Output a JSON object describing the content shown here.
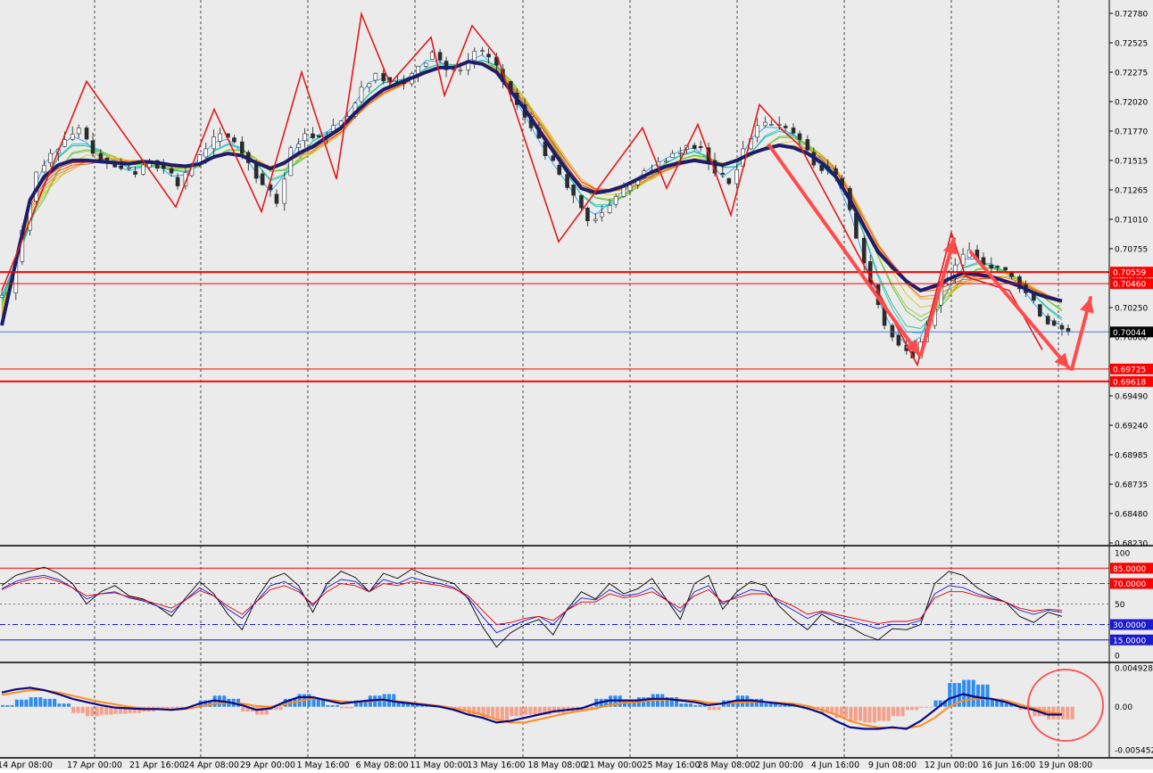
{
  "colors": {
    "background": "#ebebeb",
    "grid_vline": "#222222",
    "ema_main": "#1d1d6b",
    "zigzag": "#e11b1b",
    "arrow": "#ff4b4b",
    "level_red": "#ff0000",
    "price_line": "#4a78d6",
    "rsi_fast": "#000000",
    "rsi_mid": "#1a1ad0",
    "rsi_slow": "#e00000",
    "macd_pos": "#2f8cf0",
    "macd_neg": "#f4a08a",
    "macd_line": "#0a0a8a",
    "signal_line": "#ff8c1a",
    "circle": "#ff4b4b"
  },
  "chart_data": [
    {
      "type": "line",
      "symbol": "candlestick price panel",
      "x_labels": [
        "14 Apr 08:00",
        "17 Apr 00:00",
        "21 Apr 16:00",
        "24 Apr 08:00",
        "29 Apr 00:00",
        "1 May 16:00",
        "6 May 08:00",
        "11 May 00:00",
        "13 May 16:00",
        "18 May 08:00",
        "21 May 00:00",
        "25 May 16:00",
        "28 May 08:00",
        "2 Jun 00:00",
        "4 Jun 16:00",
        "9 Jun 08:00",
        "12 Jun 00:00",
        "16 Jun 16:00",
        "19 Jun 08:00"
      ],
      "y_ticks": [
        "0.72780",
        "0.72525",
        "0.72275",
        "0.72020",
        "0.71770",
        "0.71515",
        "0.71265",
        "0.71010",
        "0.70755",
        "0.70500",
        "0.70250",
        "0.70000",
        "0.69745",
        "0.69490",
        "0.69240",
        "0.68985",
        "0.68735",
        "0.68480",
        "0.68230"
      ],
      "ylim": [
        0.6822,
        0.7287
      ],
      "levels": [
        {
          "value": 0.70559,
          "label": "0.70559",
          "style": "thick"
        },
        {
          "value": 0.7046,
          "label": "0.70460",
          "style": "thin"
        },
        {
          "value": 0.69725,
          "label": "0.69725",
          "style": "thin"
        },
        {
          "value": 0.69618,
          "label": "0.69618",
          "style": "thick"
        }
      ],
      "current_price": {
        "value": 0.70044,
        "label": "0.70044"
      },
      "series": [
        {
          "role": "close",
          "values": [
            0.7038,
            0.7092,
            0.7142,
            0.7158,
            0.717,
            0.718,
            0.7158,
            0.715,
            0.7145,
            0.714,
            0.7152,
            0.7145,
            0.713,
            0.7148,
            0.7162,
            0.7175,
            0.7168,
            0.715,
            0.7131,
            0.7115,
            0.7163,
            0.7175,
            0.7172,
            0.7182,
            0.719,
            0.7215,
            0.7227,
            0.722,
            0.7218,
            0.7233,
            0.7245,
            0.723,
            0.723,
            0.7246,
            0.7241,
            0.722,
            0.72,
            0.718,
            0.7156,
            0.714,
            0.7122,
            0.71,
            0.7107,
            0.7121,
            0.7131,
            0.7143,
            0.7151,
            0.7158,
            0.7165,
            0.7163,
            0.7141,
            0.7132,
            0.7162,
            0.7182,
            0.7183,
            0.718,
            0.717,
            0.7148,
            0.7145,
            0.7128,
            0.7085,
            0.7045,
            0.701,
            0.6993,
            0.6982,
            0.701,
            0.7045,
            0.7062,
            0.7075,
            0.7062,
            0.706,
            0.7052,
            0.7038,
            0.7018,
            0.701,
            0.7005
          ]
        },
        {
          "role": "ema_thick",
          "values": [
            0.701,
            0.7065,
            0.7118,
            0.7138,
            0.7148,
            0.7152,
            0.7152,
            0.7151,
            0.715,
            0.7149,
            0.7151,
            0.715,
            0.7148,
            0.7147,
            0.7149,
            0.7155,
            0.7158,
            0.7156,
            0.715,
            0.7145,
            0.715,
            0.7158,
            0.7164,
            0.7172,
            0.718,
            0.7193,
            0.7204,
            0.7213,
            0.7218,
            0.7223,
            0.7228,
            0.7232,
            0.7232,
            0.7237,
            0.7235,
            0.7228,
            0.7212,
            0.7196,
            0.7178,
            0.716,
            0.7143,
            0.7128,
            0.7124,
            0.7126,
            0.713,
            0.7136,
            0.7142,
            0.7147,
            0.715,
            0.7152,
            0.715,
            0.7148,
            0.7152,
            0.7158,
            0.7162,
            0.7165,
            0.7163,
            0.7158,
            0.715,
            0.7138,
            0.7118,
            0.7095,
            0.7073,
            0.706,
            0.7048,
            0.704,
            0.7044,
            0.705,
            0.7055,
            0.7054,
            0.7052,
            0.7048,
            0.7044,
            0.7038,
            0.7034,
            0.7031
          ]
        },
        {
          "role": "zigzag",
          "values": [
            0.704,
            0.722,
            0.7112,
            0.7196,
            0.7108,
            0.7228,
            0.7136,
            0.7278,
            0.7218,
            0.7258,
            0.7208,
            0.7268,
            0.724,
            0.7082,
            0.718,
            0.7128,
            0.7183,
            0.7105,
            0.72,
            0.7178,
            0.7165,
            0.6976,
            0.709,
            0.7052,
            0.704,
            0.6989
          ]
        }
      ]
    },
    {
      "type": "line",
      "symbol": "oscillator panel",
      "y_ticks": [
        "100",
        "85.0000",
        "70.0000",
        "50",
        "30.0000",
        "15.0000",
        "0"
      ],
      "ylim": [
        0,
        100
      ],
      "levels": [
        {
          "value": 85,
          "label": "85.0000"
        },
        {
          "value": 70,
          "label": "70.0000"
        },
        {
          "value": 50,
          "label": "50"
        },
        {
          "value": 30,
          "label": "30.0000"
        },
        {
          "value": 15,
          "label": "15.0000"
        }
      ],
      "series": [
        {
          "role": "fast",
          "values": [
            68,
            78,
            82,
            86,
            80,
            70,
            50,
            62,
            68,
            58,
            55,
            48,
            38,
            56,
            72,
            60,
            40,
            25,
            55,
            75,
            80,
            68,
            42,
            70,
            82,
            76,
            62,
            80,
            75,
            84,
            78,
            74,
            70,
            55,
            28,
            8,
            22,
            30,
            35,
            20,
            45,
            62,
            55,
            70,
            60,
            65,
            75,
            55,
            35,
            70,
            78,
            45,
            62,
            72,
            68,
            48,
            35,
            25,
            40,
            32,
            28,
            20,
            15,
            26,
            25,
            30,
            70,
            82,
            78,
            66,
            58,
            52,
            38,
            32,
            42,
            38
          ]
        },
        {
          "role": "mid",
          "values": [
            65,
            72,
            76,
            78,
            74,
            66,
            55,
            60,
            62,
            56,
            53,
            48,
            42,
            54,
            66,
            58,
            45,
            36,
            52,
            68,
            72,
            64,
            48,
            66,
            74,
            72,
            62,
            74,
            70,
            76,
            72,
            70,
            66,
            56,
            38,
            22,
            28,
            34,
            38,
            30,
            44,
            56,
            54,
            64,
            58,
            60,
            66,
            54,
            42,
            62,
            68,
            50,
            58,
            64,
            62,
            52,
            44,
            36,
            42,
            38,
            34,
            30,
            26,
            30,
            30,
            34,
            60,
            68,
            66,
            60,
            56,
            52,
            44,
            40,
            44,
            42
          ]
        },
        {
          "role": "slow",
          "values": [
            64,
            70,
            74,
            76,
            72,
            66,
            58,
            60,
            61,
            57,
            54,
            50,
            46,
            54,
            63,
            58,
            48,
            40,
            52,
            64,
            68,
            62,
            50,
            62,
            70,
            68,
            62,
            70,
            68,
            72,
            70,
            68,
            65,
            58,
            44,
            30,
            32,
            36,
            38,
            34,
            44,
            52,
            52,
            60,
            56,
            58,
            62,
            54,
            46,
            58,
            64,
            52,
            56,
            60,
            60,
            54,
            48,
            40,
            43,
            40,
            37,
            34,
            31,
            33,
            33,
            36,
            56,
            62,
            62,
            58,
            55,
            52,
            46,
            43,
            45,
            44
          ]
        }
      ]
    },
    {
      "type": "bar",
      "symbol": "MACD histogram panel",
      "y_ticks": [
        "0.0049282",
        "0.00",
        "-0.005452"
      ],
      "ylim": [
        -0.005452,
        0.0049282
      ],
      "series": [
        {
          "role": "histogram",
          "values": [
            0.0002,
            0.0009,
            0.0012,
            0.001,
            0.0004,
            -0.0008,
            -0.0012,
            -0.001,
            -0.0009,
            -0.0008,
            -0.0006,
            -0.0004,
            -0.0003,
            -0.0002,
            0.0008,
            0.0014,
            0.001,
            -0.0006,
            -0.001,
            -0.0004,
            0.001,
            0.0016,
            0.001,
            0.0002,
            -0.0002,
            0.0008,
            0.0014,
            0.0016,
            0.0006,
            0.0004,
            0.0002,
            0.0,
            -0.0006,
            -0.001,
            -0.0014,
            -0.0018,
            -0.0012,
            -0.001,
            -0.001,
            -0.0008,
            -0.0006,
            -0.0004,
            0.001,
            0.0014,
            0.0008,
            0.0012,
            0.0016,
            0.0012,
            0.0004,
            0.0002,
            -0.0004,
            0.0008,
            0.0014,
            0.001,
            0.0004,
            0.0002,
            0.0001,
            -0.0004,
            -0.0008,
            -0.0014,
            -0.0018,
            -0.002,
            -0.0018,
            -0.0012,
            -0.0004,
            -0.0001,
            0.0008,
            0.003,
            0.0034,
            0.0028,
            0.001,
            0.0004,
            -0.0004,
            -0.0012,
            -0.0016,
            -0.0016
          ]
        },
        {
          "role": "macd",
          "values": [
            0.0018,
            0.0022,
            0.0024,
            0.0021,
            0.0016,
            0.001,
            0.0006,
            0.0002,
            -0.0001,
            -0.0002,
            -0.0003,
            -0.0003,
            -0.0004,
            -0.0002,
            0.0004,
            0.0008,
            0.0006,
            0.0002,
            -0.0004,
            -0.0002,
            0.0006,
            0.0012,
            0.0012,
            0.0008,
            0.0004,
            0.0006,
            0.0008,
            0.0009,
            0.0006,
            0.0004,
            0.0002,
            0.0,
            -0.0004,
            -0.001,
            -0.0014,
            -0.002,
            -0.0018,
            -0.0014,
            -0.001,
            -0.0006,
            -0.0004,
            -0.0002,
            0.0004,
            0.0008,
            0.0008,
            0.0008,
            0.001,
            0.001,
            0.0008,
            0.0006,
            0.0002,
            0.0004,
            0.0008,
            0.0008,
            0.0006,
            0.0004,
            0.0002,
            -0.0002,
            -0.0008,
            -0.0018,
            -0.0026,
            -0.0028,
            -0.0028,
            -0.0026,
            -0.0028,
            -0.0018,
            -0.0004,
            0.001,
            0.0016,
            0.0012,
            0.001,
            0.0006,
            0.0,
            -0.0004,
            -0.001,
            -0.001
          ]
        },
        {
          "role": "signal",
          "values": [
            0.0015,
            0.0018,
            0.0021,
            0.0021,
            0.0018,
            0.0014,
            0.001,
            0.0006,
            0.0003,
            0.0,
            -0.0002,
            -0.0003,
            -0.0004,
            -0.0003,
            0.0,
            0.0004,
            0.0005,
            0.0004,
            0.0001,
            0.0,
            0.0003,
            0.0007,
            0.001,
            0.0009,
            0.0007,
            0.0006,
            0.0007,
            0.0008,
            0.0007,
            0.0005,
            0.0003,
            0.0001,
            -0.0002,
            -0.0006,
            -0.001,
            -0.0016,
            -0.002,
            -0.002,
            -0.0016,
            -0.0012,
            -0.0008,
            -0.0005,
            -0.0002,
            0.0002,
            0.0005,
            0.0006,
            0.0008,
            0.0009,
            0.0009,
            0.0008,
            0.0005,
            0.0004,
            0.0005,
            0.0006,
            0.0006,
            0.0005,
            0.0004,
            0.0001,
            -0.0004,
            -0.001,
            -0.0018,
            -0.0023,
            -0.0026,
            -0.0027,
            -0.0027,
            -0.0024,
            -0.0014,
            0.0,
            0.0008,
            0.001,
            0.001,
            0.0008,
            0.0003,
            -0.0002,
            -0.0007,
            -0.0009
          ]
        }
      ]
    }
  ]
}
